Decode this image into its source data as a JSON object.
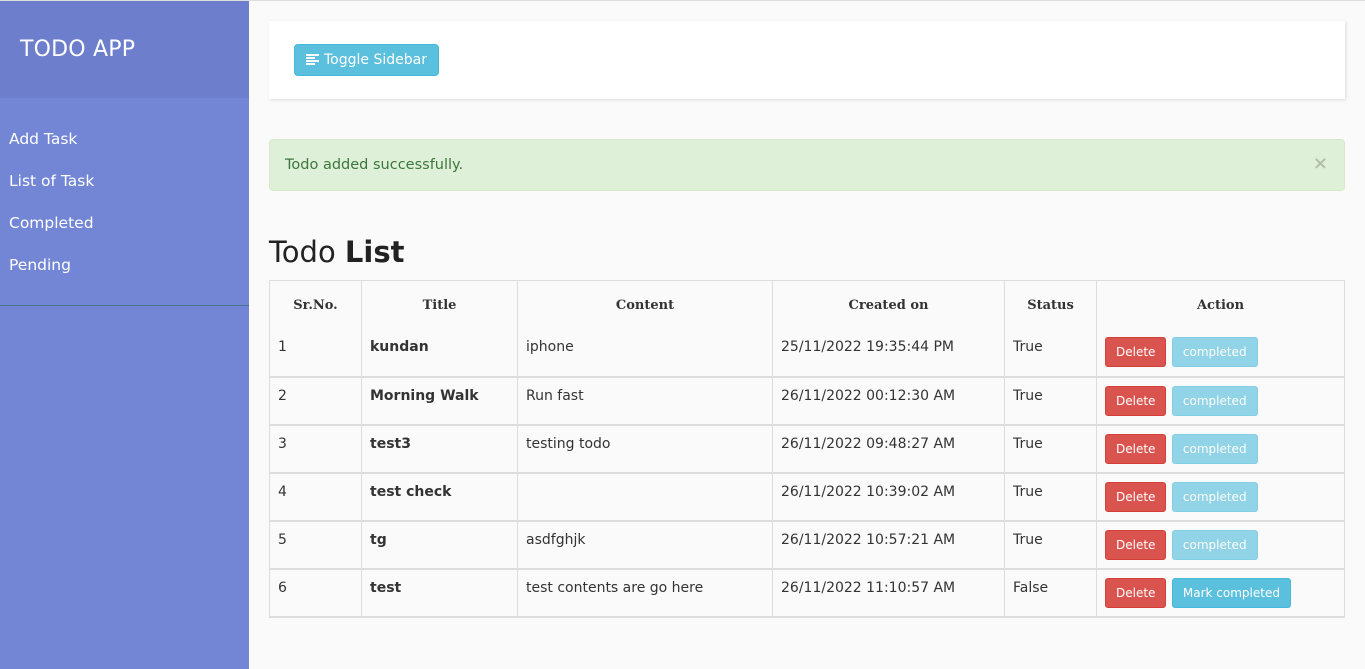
{
  "sidebar": {
    "title": "TODO APP",
    "items": [
      {
        "label": "Add Task"
      },
      {
        "label": "List of Task"
      },
      {
        "label": "Completed"
      },
      {
        "label": "Pending"
      }
    ]
  },
  "navbar": {
    "toggle_label": "Toggle Sidebar"
  },
  "alert": {
    "message": "Todo added successfully.",
    "close": "×"
  },
  "heading": {
    "normal": "Todo ",
    "bold": "List"
  },
  "table": {
    "headers": [
      "Sr.No.",
      "Title",
      "Content",
      "Created on",
      "Status",
      "Action"
    ],
    "rows": [
      {
        "no": "1",
        "title": "kundan",
        "content": "iphone",
        "created": "25/11/2022 19:35:44 PM",
        "status": "True",
        "delete": "Delete",
        "action": "completed",
        "done": true
      },
      {
        "no": "2",
        "title": "Morning Walk",
        "content": "Run fast",
        "created": "26/11/2022 00:12:30 AM",
        "status": "True",
        "delete": "Delete",
        "action": "completed",
        "done": true
      },
      {
        "no": "3",
        "title": "test3",
        "content": "testing todo",
        "created": "26/11/2022 09:48:27 AM",
        "status": "True",
        "delete": "Delete",
        "action": "completed",
        "done": true
      },
      {
        "no": "4",
        "title": "test check",
        "content": "",
        "created": "26/11/2022 10:39:02 AM",
        "status": "True",
        "delete": "Delete",
        "action": "completed",
        "done": true
      },
      {
        "no": "5",
        "title": "tg",
        "content": "asdfghjk",
        "created": "26/11/2022 10:57:21 AM",
        "status": "True",
        "delete": "Delete",
        "action": "completed",
        "done": true
      },
      {
        "no": "6",
        "title": "test",
        "content": "test contents are go here",
        "created": "26/11/2022 11:10:57 AM",
        "status": "False",
        "delete": "Delete",
        "action": "Mark completed",
        "done": false
      }
    ]
  },
  "colors": {
    "sidebar": "#7386d5",
    "sidebar_header": "#6d7fcc",
    "info": "#5bc0de",
    "danger": "#d9534f",
    "success_bg": "#dff0d8"
  },
  "icons": {
    "toggle": "align-left-icon",
    "close": "close-icon"
  }
}
